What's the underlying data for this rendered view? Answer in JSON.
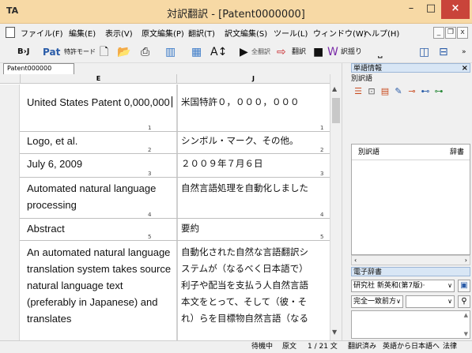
{
  "window": {
    "app_icon": "TA",
    "title": "対訳翻訳 - [Patent0000000]",
    "minimize": "–",
    "maximize": "□",
    "close": "×"
  },
  "menu": {
    "items": [
      {
        "label": "ファイル(F)"
      },
      {
        "label": "編集(E)"
      },
      {
        "label": "表示(V)"
      },
      {
        "label": "原文編集(P)"
      },
      {
        "label": "翻訳(T)"
      },
      {
        "label": "訳文編集(S)"
      },
      {
        "label": "ツール(L)"
      },
      {
        "label": "ウィンドウ(W)"
      },
      {
        "label": "ヘルプ(H)"
      }
    ],
    "mdi_min": "_",
    "mdi_restore": "❐",
    "mdi_close": "x"
  },
  "toolbar": {
    "bj_label": "B›J",
    "pat_label": "Pat",
    "patent_mode": "特許モード",
    "translate_all": "全翻訳",
    "translate": "翻訳",
    "alternatives": "訳揺り"
  },
  "document": {
    "tab": "Patent000000",
    "col_e": "E",
    "col_j": "J"
  },
  "segments": [
    {
      "num": "1",
      "en": "United States Patent 0,000,000",
      "ja": "米国特許０，０００，０００"
    },
    {
      "num": "2",
      "en": "Logo, et al.",
      "ja": "シンボル・マーク、その他。"
    },
    {
      "num": "3",
      "en": "July 6, 2009",
      "ja": "２００９年７月６日"
    },
    {
      "num": "4",
      "en": "Automated natural language processing",
      "ja": "自然言語処理を自動化しました"
    },
    {
      "num": "5",
      "en": "Abstract",
      "ja": "要約"
    },
    {
      "num": "",
      "en": "An automated natural language translation system takes source natural language text (preferably in Japanese) and translates",
      "ja_lines": [
        "自動化された自然な言語翻訳シ",
        "ステムが（なるべく日本語で）",
        "利子や配当を支払う人自然言語",
        "本文をとって、そして（彼・そ",
        "れ）らを目標物自然言語（なる"
      ]
    }
  ],
  "word_panel": {
    "title": "単語情報",
    "close": "×",
    "subtitle": "別訳語",
    "list_col1": "別訳語",
    "list_col2": "辞書"
  },
  "dict_panel": {
    "title": "電子辞書",
    "dictionary": "研究社 新英和(第7版)·",
    "match_mode": "完全一致前方",
    "search_value": ""
  },
  "status": {
    "state": "待機中",
    "field": "原文",
    "position": "1 / 21 文",
    "translated": "翻訳済み",
    "direction": "英語から日本語へ",
    "domain": "法律"
  }
}
